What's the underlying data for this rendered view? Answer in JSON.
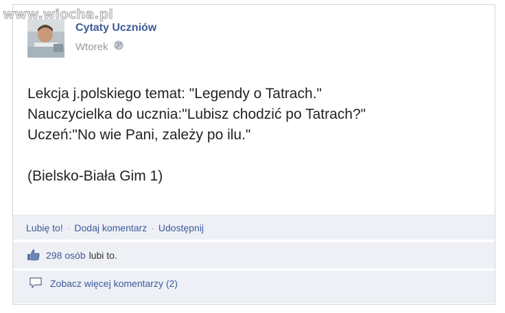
{
  "watermark": {
    "text": "www.wiocha.pl"
  },
  "post": {
    "page_name": "Cytaty Uczniów",
    "timestamp": "Wtorek",
    "privacy_icon": "globe-icon",
    "lines": [
      "Lekcja j.polskiego temat: \"Legendy o Tatrach.\"",
      "Nauczycielka do ucznia:\"Lubisz chodzić po Tatrach?\"",
      "Uczeń:\"No wie Pani, zależy po ilu.\"",
      "",
      "(Bielsko-Biała Gim 1)"
    ]
  },
  "actions": {
    "like": "Lubię to!",
    "separator": "·",
    "comment": "Dodaj komentarz",
    "share": "Udostępnij"
  },
  "likes": {
    "icon": "thumbs-up-icon",
    "count": "298 osób",
    "rest": "lubi to."
  },
  "comments": {
    "icon": "comment-bubble-icon",
    "label": "Zobacz więcej komentarzy (2)"
  },
  "colors": {
    "link": "#3b5998",
    "panel": "#eef0f6",
    "text": "#222222",
    "meta": "#999999"
  }
}
